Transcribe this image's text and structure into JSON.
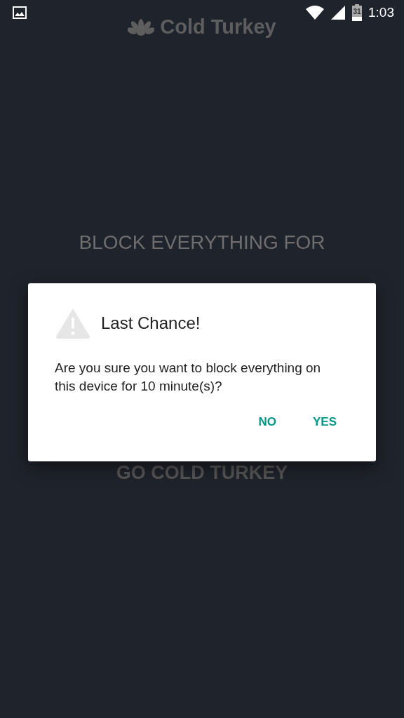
{
  "status_bar": {
    "battery": "31",
    "time": "1:03"
  },
  "app_title": "Cold Turkey",
  "heading": "BLOCK EVERYTHING FOR",
  "start_button": "GO COLD TURKEY",
  "dialog": {
    "title": "Last Chance!",
    "message": "Are you sure you want to block everything on this device for 10 minute(s)?",
    "buttons": [
      "NO",
      "YES"
    ]
  }
}
